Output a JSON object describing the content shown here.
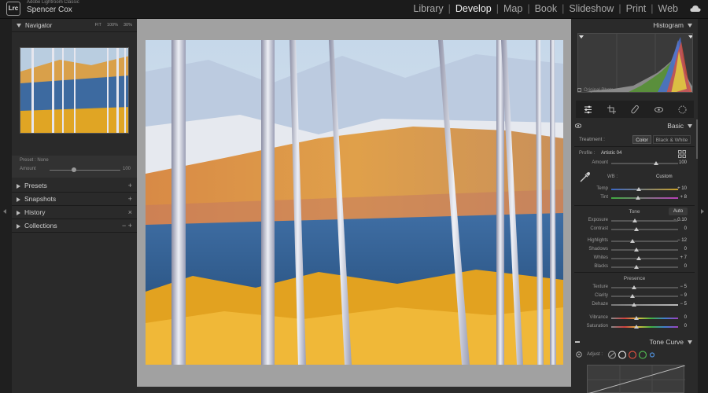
{
  "topbar": {
    "logo": "Lrc",
    "product": "Adobe Lightroom Classic",
    "user": "Spencer Cox",
    "modules": [
      "Library",
      "Develop",
      "Map",
      "Book",
      "Slideshow",
      "Print",
      "Web"
    ],
    "active_module": "Develop"
  },
  "left": {
    "navigator": {
      "title": "Navigator",
      "zoom": [
        "FIT",
        "100%",
        "30%"
      ]
    },
    "preset": {
      "name": "Preset : None",
      "amount_label": "Amount",
      "amount_value": "100"
    },
    "sections": [
      {
        "label": "Presets",
        "action": "+"
      },
      {
        "label": "Snapshots",
        "action": "+"
      },
      {
        "label": "History",
        "action": "×"
      },
      {
        "label": "Collections",
        "action": "−  +"
      }
    ]
  },
  "right": {
    "histogram": {
      "title": "Histogram",
      "original_photo": "Original Photo"
    },
    "basic": {
      "title": "Basic",
      "treatment_label": "Treatment :",
      "treatment_color": "Color",
      "treatment_bw": "Black & White",
      "profile_label": "Profile :",
      "profile_value": "Artistic 04",
      "amount_label": "Amount",
      "amount_value": "100",
      "wb_label": "WB :",
      "wb_value": "Custom",
      "temp": {
        "label": "Temp",
        "value": "+ 10"
      },
      "tint": {
        "label": "Tint",
        "value": "+ 8"
      },
      "tone_label": "Tone",
      "auto_label": "Auto",
      "exposure": {
        "label": "Exposure",
        "value": "− 0.10"
      },
      "contrast": {
        "label": "Contrast",
        "value": "0"
      },
      "highlights": {
        "label": "Highlights",
        "value": "− 12"
      },
      "shadows": {
        "label": "Shadows",
        "value": "0"
      },
      "whites": {
        "label": "Whites",
        "value": "+ 7"
      },
      "blacks": {
        "label": "Blacks",
        "value": "0"
      },
      "presence_label": "Presence",
      "texture": {
        "label": "Texture",
        "value": "− 5"
      },
      "clarity": {
        "label": "Clarity",
        "value": "− 9"
      },
      "dehaze": {
        "label": "Dehaze",
        "value": "− 5"
      },
      "vibrance": {
        "label": "Vibrance",
        "value": "0"
      },
      "saturation": {
        "label": "Saturation",
        "value": "0"
      }
    },
    "tone_curve": {
      "title": "Tone Curve",
      "adjust_label": "Adjust :"
    }
  },
  "colors": {
    "accent_red": "#d9503f",
    "accent_green": "#4fb34f",
    "accent_blue": "#4f8fd9"
  },
  "icons": [
    "cloud-icon",
    "eye-icon",
    "edit-sliders-icon",
    "crop-icon",
    "healing-brush-icon",
    "red-eye-icon",
    "masking-icon",
    "color-picker-icon"
  ]
}
